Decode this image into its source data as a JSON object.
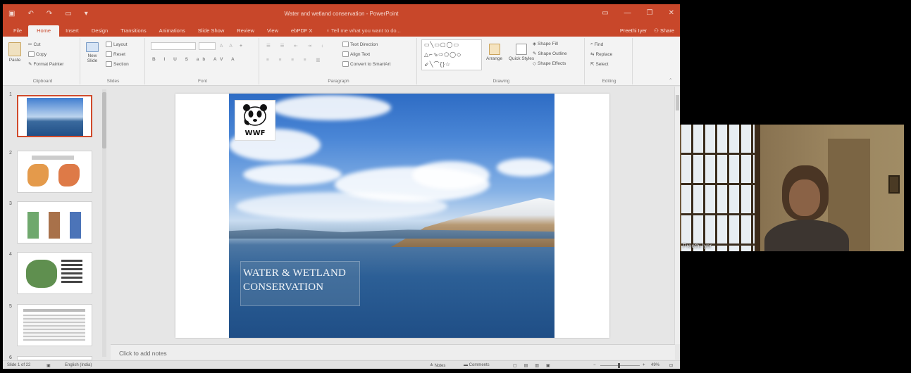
{
  "window": {
    "title": "Water and wetland conservation - PowerPoint",
    "qat": [
      "save-icon",
      "undo-icon",
      "redo-icon",
      "start-icon",
      "customize-icon"
    ],
    "controls": [
      "ribbon-display-icon",
      "minimize-icon",
      "restore-icon",
      "close-icon"
    ]
  },
  "tabs": [
    "File",
    "Home",
    "Insert",
    "Design",
    "Transitions",
    "Animations",
    "Slide Show",
    "Review",
    "View",
    "ebPDF X"
  ],
  "tell_me": "Tell me what you want to do...",
  "account": {
    "user": "Preethi Iyer",
    "share": "Share"
  },
  "ribbon": {
    "clipboard": {
      "paste": "Paste",
      "cut": "Cut",
      "copy": "Copy",
      "format_painter": "Format Painter",
      "label": "Clipboard"
    },
    "slides": {
      "new_slide": "New Slide",
      "layout": "Layout",
      "reset": "Reset",
      "section": "Section",
      "label": "Slides"
    },
    "font": {
      "label": "Font"
    },
    "paragraph": {
      "text_direction": "Text Direction",
      "align_text": "Align Text",
      "smartart": "Convert to SmartArt",
      "label": "Paragraph"
    },
    "drawing": {
      "arrange": "Arrange",
      "quick_styles": "Quick Styles",
      "shape_fill": "Shape Fill",
      "shape_outline": "Shape Outline",
      "shape_effects": "Shape Effects",
      "label": "Drawing"
    },
    "editing": {
      "find": "Find",
      "replace": "Replace",
      "select": "Select",
      "label": "Editing"
    }
  },
  "thumbnails": [
    "1",
    "2",
    "3",
    "4",
    "5",
    "6"
  ],
  "slide": {
    "logo_text": "WWF",
    "title_line1": "WATER & WETLAND",
    "title_line2": "CONSERVATION"
  },
  "notes_placeholder": "Click to add notes",
  "status": {
    "slide_info": "Slide 1 of 22",
    "language": "English (India)",
    "notes": "Notes",
    "comments": "Comments",
    "zoom": "49%"
  },
  "camera": {
    "participant": "Preethi Iyer"
  }
}
